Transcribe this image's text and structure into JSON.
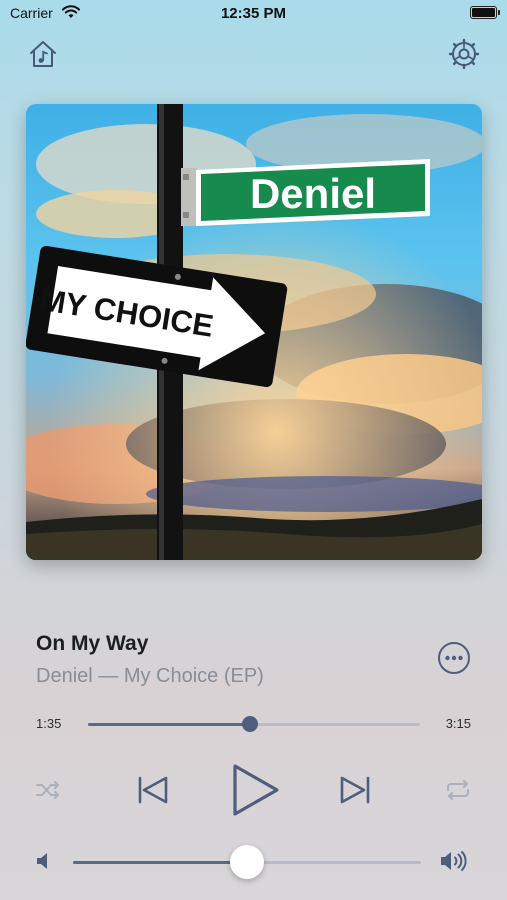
{
  "status_bar": {
    "carrier": "Carrier",
    "time": "12:35 PM"
  },
  "artwork": {
    "street_sign": "Deniel",
    "arrow_sign": "MY CHOICE"
  },
  "now_playing": {
    "title": "On My Way",
    "subtitle": "Deniel — My Choice (EP)",
    "elapsed": "1:35",
    "duration": "3:15",
    "progress": 0.487
  },
  "volume": {
    "level": 0.5
  },
  "icons": {
    "home": "home-music-icon",
    "settings": "gear-icon",
    "more": "more-ellipsis-icon",
    "shuffle": "shuffle-icon",
    "previous": "previous-track-icon",
    "play": "play-icon",
    "next": "next-track-icon",
    "repeat": "repeat-icon",
    "volume_low": "volume-low-icon",
    "volume_high": "volume-high-icon"
  },
  "colors": {
    "accent": "#4e5e7c",
    "disabled": "#a9b0be",
    "subtitle": "#8a8d95"
  }
}
